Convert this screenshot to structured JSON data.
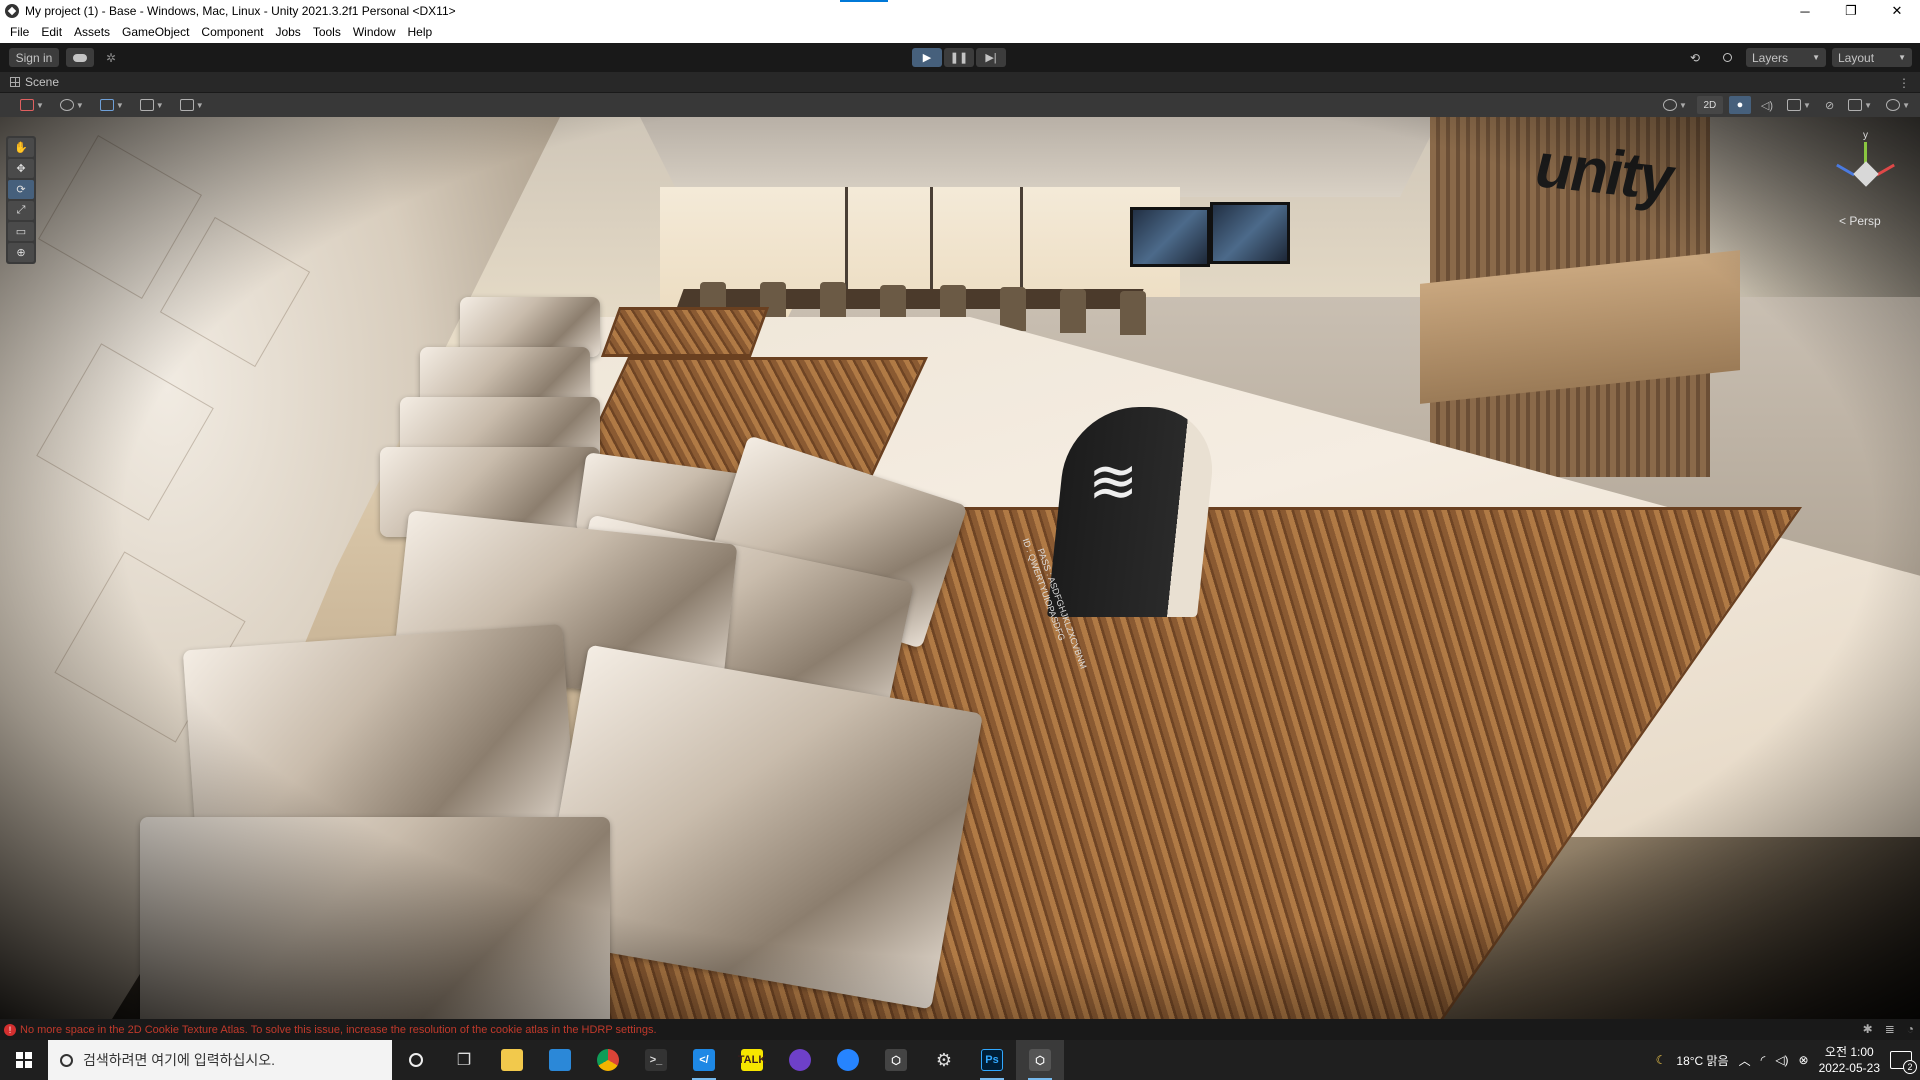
{
  "window": {
    "title": "My project (1) - Base - Windows, Mac, Linux - Unity 2021.3.2f1 Personal <DX11>",
    "minimize": "─",
    "maximize": "❐",
    "close": "✕"
  },
  "menu": {
    "items": [
      "File",
      "Edit",
      "Assets",
      "GameObject",
      "Component",
      "Jobs",
      "Tools",
      "Window",
      "Help"
    ]
  },
  "toolbar": {
    "sign_in": "Sign in",
    "play": "▶",
    "pause": "❚❚",
    "step": "▶|",
    "layers_label": "Layers",
    "layout_label": "Layout"
  },
  "scene": {
    "tab_label": "Scene",
    "mode_2d": "2D",
    "persp_label": "< Persp",
    "gizmo_y": "y",
    "unity_logo_text": "unity",
    "wifi_glyph": "≋",
    "wifi_text_1": "ID : QWERTYUIOPASDFG",
    "wifi_text_2": "PASS : ASDFGHJKLZXCVBNM"
  },
  "status": {
    "message": "No more space in the 2D Cookie Texture Atlas. To solve this issue, increase the resolution of the cookie atlas in the HDRP settings."
  },
  "taskbar": {
    "search_placeholder": "검색하려면 여기에 입력하십시오.",
    "weather": "18°C 맑음",
    "clock_time": "오전 1:00",
    "clock_date": "2022-05-23",
    "notification_count": "2"
  },
  "icons": {
    "tools": [
      "hand-tool-icon",
      "move-tool-icon",
      "rotate-tool-icon",
      "scale-tool-icon",
      "rect-tool-icon",
      "transform-tool-icon"
    ]
  },
  "colors": {
    "accent": "#46607c",
    "error": "#c0392b",
    "taskbar_running": "#76b9ed"
  }
}
